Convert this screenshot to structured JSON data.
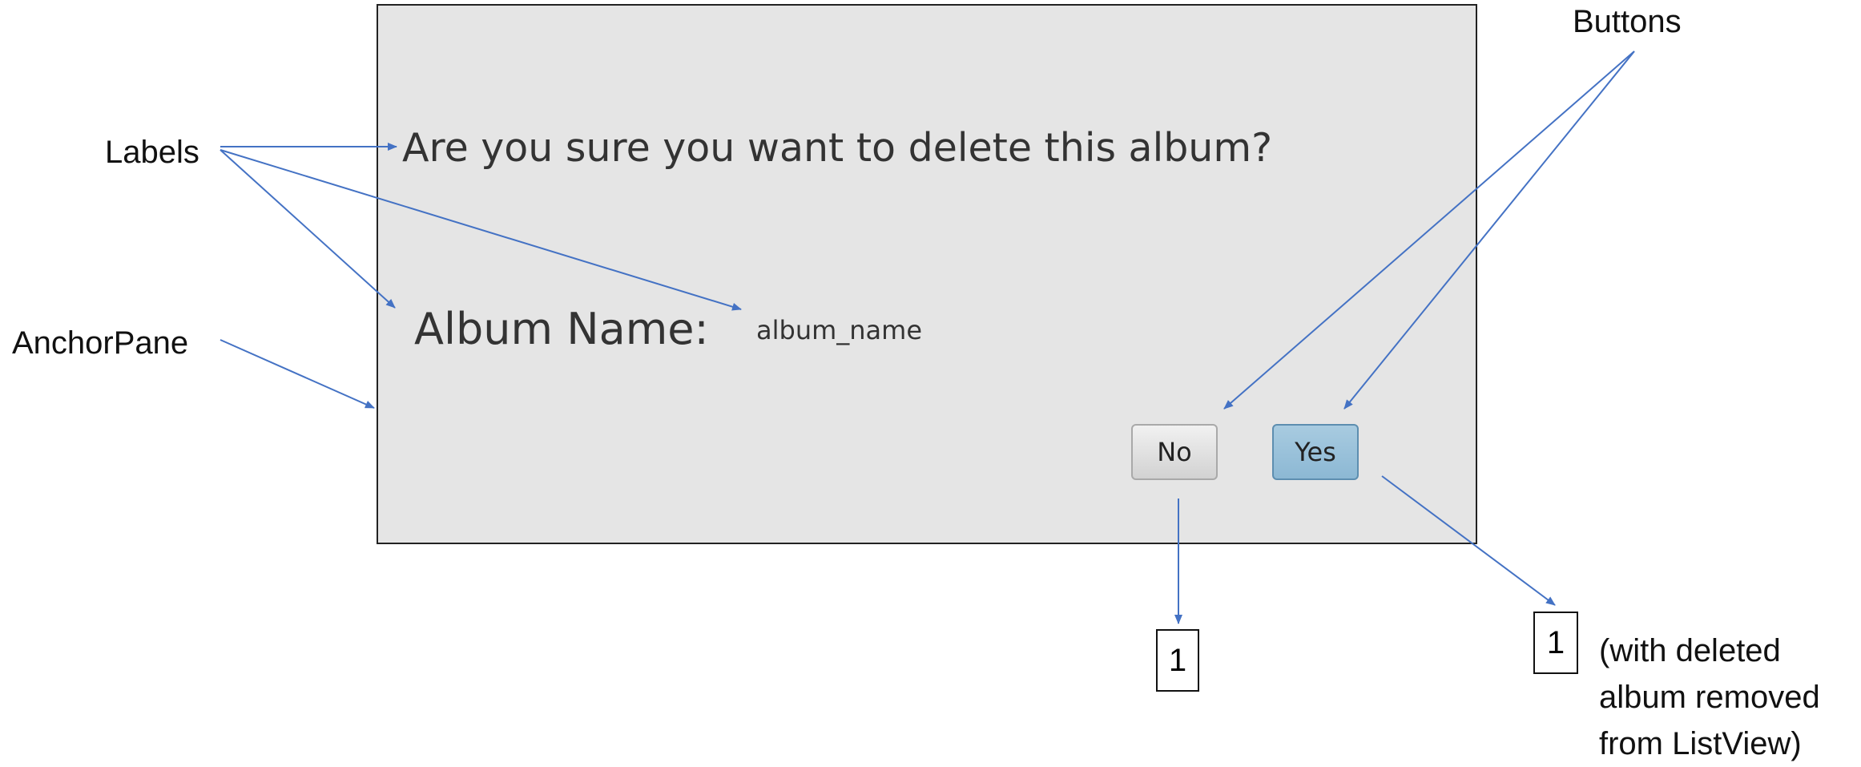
{
  "callouts": {
    "labels": "Labels",
    "buttons": "Buttons",
    "anchor_pane": "AnchorPane"
  },
  "dialog": {
    "question": "Are you sure you want to delete this album?",
    "album_name_label": "Album Name:",
    "album_name_value": "album_name",
    "no_button": "No",
    "yes_button": "Yes"
  },
  "results": {
    "no_target": "1",
    "yes_target": "1",
    "yes_note_line1": "(with deleted",
    "yes_note_line2": "album removed",
    "yes_note_line3": "from ListView)"
  },
  "colors": {
    "arrow": "#4472c4",
    "pane_background": "#e5e5e5",
    "yes_button": "#95c0d9"
  }
}
